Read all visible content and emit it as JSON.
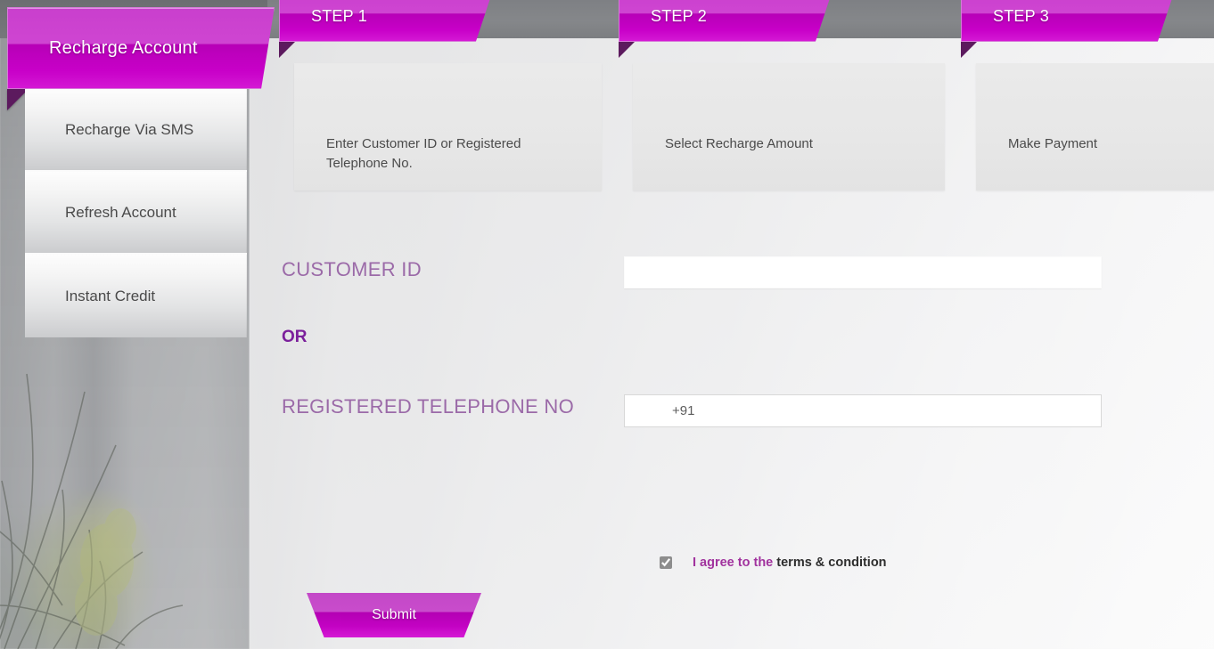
{
  "sidebar": {
    "header_title": "Recharge Account",
    "items": [
      {
        "label": "Recharge Via SMS"
      },
      {
        "label": "Refresh Account"
      },
      {
        "label": "Instant Credit"
      }
    ]
  },
  "steps": [
    {
      "title": "STEP 1",
      "description": "Enter Customer ID or Registered Telephone No."
    },
    {
      "title": "STEP 2",
      "description": "Select Recharge Amount"
    },
    {
      "title": "STEP 3",
      "description": "Make Payment"
    }
  ],
  "form": {
    "customer_id_label": "CUSTOMER ID",
    "customer_id_value": "",
    "customer_id_placeholder": "",
    "or_label": "OR",
    "telephone_label": "REGISTERED TELEPHONE NO",
    "telephone_value": "",
    "telephone_placeholder": "+91"
  },
  "terms": {
    "checked": true,
    "link_text": "I agree to the",
    "plain_text": "terms & condition"
  },
  "actions": {
    "submit_label": "Submit"
  },
  "colors": {
    "ribbon_light": "#c93fcd",
    "ribbon_dark": "#b700b7",
    "fold": "#5c1a5e",
    "label_purple": "#9b6aa8",
    "or_purple": "#7b1f9b",
    "terms_link": "#a1339e"
  }
}
